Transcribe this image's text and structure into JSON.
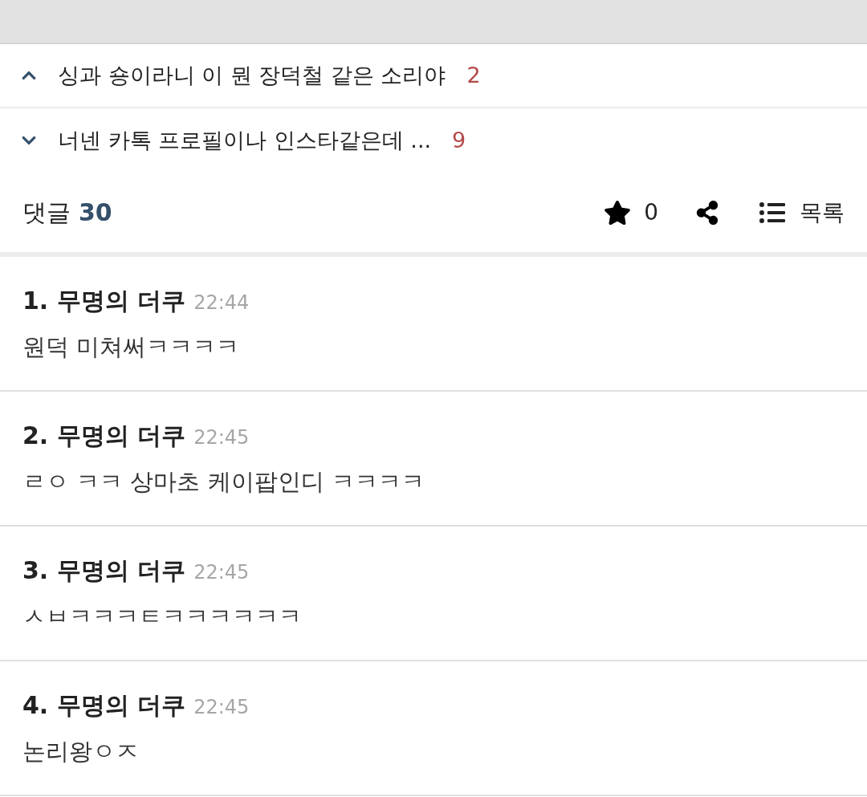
{
  "related_posts": [
    {
      "kind": "prev",
      "title": "싱과 숑이라니 이 뭔 장덕철 같은 소리야",
      "count": "2"
    },
    {
      "kind": "next",
      "title": "너넨 카톡 프로필이나 인스타같은데 ...",
      "count": "9"
    }
  ],
  "comment_bar": {
    "label": "댓글",
    "count": "30",
    "stars": "0",
    "list_label": "목록"
  },
  "comments": [
    {
      "number": "1.",
      "author": "무명의 더쿠",
      "time": "22:44",
      "text": "원덕 미쳐써ㅋㅋㅋㅋ"
    },
    {
      "number": "2.",
      "author": "무명의 더쿠",
      "time": "22:45",
      "text": "ㄹㅇ ㅋㅋ 상마초 케이팝인디 ㅋㅋㅋㅋ"
    },
    {
      "number": "3.",
      "author": "무명의 더쿠",
      "time": "22:45",
      "text": "ㅅㅂㅋㅋㅋㅌㅋㅋㅋㅋㅋㅋ"
    },
    {
      "number": "4.",
      "author": "무명의 더쿠",
      "time": "22:45",
      "text": "논리왕ㅇㅈ"
    }
  ]
}
